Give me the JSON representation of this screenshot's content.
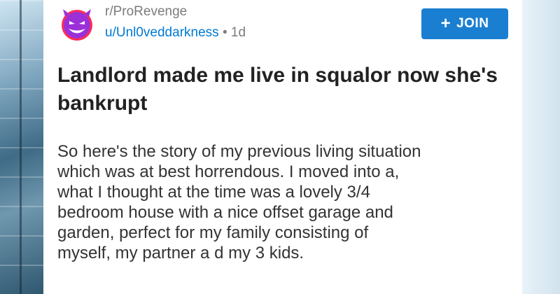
{
  "post": {
    "subreddit": "r/ProRevenge",
    "author": "u/Unl0veddarkness",
    "separator": "•",
    "age": "1d",
    "join_label": "JOIN",
    "join_icon": "plus-icon",
    "title": "Landlord made me live in squalor now she's bankrupt",
    "body_lines": [
      "So here's the story of my previous living situation",
      "which was at best horrendous. I moved into a,",
      "what I thought at the time was a lovely 3/4",
      "bedroom house with a nice offset garage and",
      "garden, perfect for my family consisting of",
      "myself, my partner a d my 3 kids."
    ]
  },
  "colors": {
    "accent": "#1a7fd1",
    "username": "#0079d3",
    "meta": "#7c7c7c",
    "title": "#222222",
    "body": "#333333",
    "avatar": "#9b30d9"
  }
}
